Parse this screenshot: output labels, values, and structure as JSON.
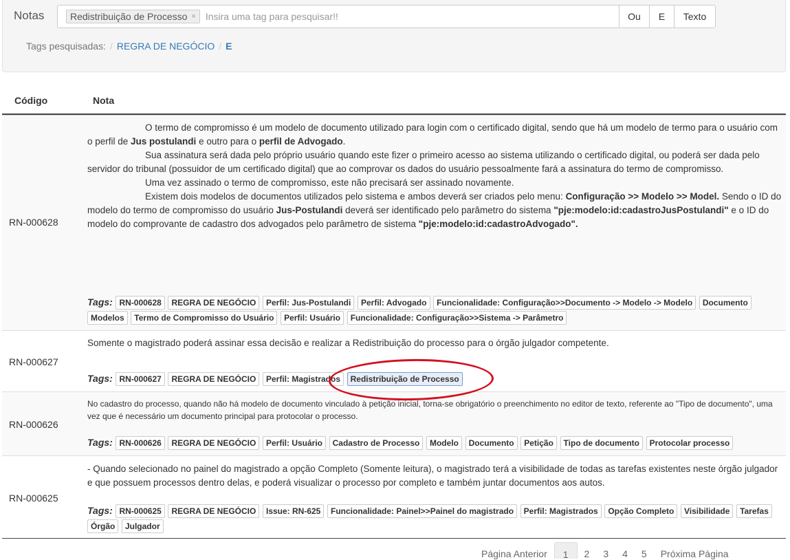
{
  "search": {
    "title": "Notas",
    "chip_label": "Redistribuição de Processo",
    "chip_remove": "×",
    "placeholder": "Insira uma tag para pesquisar!!",
    "btn_or": "Ou",
    "btn_and": "E",
    "btn_text": "Texto"
  },
  "breadcrumb": {
    "label": "Tags pesquisadas:",
    "sep": "/",
    "item1": "REGRA DE NEGÓCIO",
    "item2": "E"
  },
  "table": {
    "col_code": "Código",
    "col_note": "Nota"
  },
  "rows": [
    {
      "code": "RN-000628",
      "p1": "O termo de compromisso é um modelo de documento utilizado para login com o certificado digital, sendo que há um modelo de termo para o usuário com o perfil de ",
      "p1_b1": "Jus postulandi",
      "p1_mid": " e outro para o ",
      "p1_b2": "perfil de Advogado",
      "p1_end": ".",
      "p2": "Sua assinatura será dada pelo próprio usuário quando este fizer o primeiro acesso ao sistema utilizando o certificado digital, ou poderá ser dada pelo servidor do tribunal (possuidor de um certificado digital) que ao comprovar os dados do usuário pessoalmente fará a assinatura do termo de compromisso.",
      "p3": "Uma vez assinado o termo de compromisso, este não precisará ser assinado novamente.",
      "p4_a": "Existem dois modelos de documentos utilizados pelo sistema e ambos deverá ser criados pelo menu: ",
      "p4_b1": "Configuração >> Modelo >> Model.",
      "p4_c": " Sendo o ID do modelo do termo de compromisso do usuário ",
      "p4_b2": "Jus-Postulandi",
      "p4_d": " deverá ser identificado pelo parâmetro do sistema ",
      "p4_b3": "\"pje:modelo:id:cadastroJusPostulandi\"",
      "p4_e": " e o ID do modelo do comprovante de cadastro dos advogados pelo parâmetro de sistema ",
      "p4_b4": "\"pje:modelo:id:cadastroAdvogado\".",
      "tags_label": "Tags:",
      "tags": [
        "RN-000628",
        "REGRA DE NEGÓCIO",
        "Perfil: Jus-Postulandi",
        "Perfil: Advogado",
        "Funcionalidade: Configuração>>Documento -> Modelo -> Modelo",
        "Documento",
        "Modelos",
        "Termo de Compromisso do Usuário",
        "Perfil: Usuário",
        "Funcionalidade: Configuração>>Sistema -> Parâmetro"
      ]
    },
    {
      "code": "RN-000627",
      "text": "Somente o magistrado poderá assinar essa decisão e realizar a Redistribuição do processo para o órgão julgador competente.",
      "tags_label": "Tags:",
      "tags": [
        "RN-000627",
        "REGRA DE NEGÓCIO",
        "Perfil: Magistrados",
        "Redistribuição de Processo"
      ]
    },
    {
      "code": "RN-000626",
      "text": "No cadastro do processo, quando não há modelo de documento vinculado à petição inicial, torna-se obrigatório o preenchimento no editor de texto, referente ao \"Tipo de documento\", uma vez que é necessário um documento principal para protocolar o processo.",
      "tags_label": "Tags:",
      "tags": [
        "RN-000626",
        "REGRA DE NEGÓCIO",
        "Perfil: Usuário",
        "Cadastro de Processo",
        "Modelo",
        "Documento",
        "Petição",
        "Tipo de documento",
        "Protocolar processo"
      ]
    },
    {
      "code": "RN-000625",
      "text": "- Quando selecionado no painel do magistrado a opção Completo (Somente leitura), o magistrado terá a visibilidade de todas as tarefas existentes neste órgão julgador e que possuem processos dentro delas, e poderá visualizar o processo por completo e também juntar documentos aos autos.",
      "tags_label": "Tags:",
      "tags": [
        "RN-000625",
        "REGRA DE NEGÓCIO",
        "Issue: RN-625",
        "Funcionalidade: Painel>>Painel do magistrado",
        "Perfil: Magistrados",
        "Opção Completo",
        "Visibilidade",
        "Tarefas",
        "Órgão",
        "Julgador"
      ]
    }
  ],
  "pagination": {
    "prev": "Página Anterior",
    "pages": [
      "1",
      "2",
      "3",
      "4",
      "5"
    ],
    "next": "Próxima Página"
  },
  "colors": {
    "link": "#337ab7",
    "annotation": "#d3111f"
  }
}
